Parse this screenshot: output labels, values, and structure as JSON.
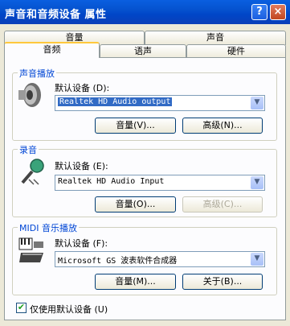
{
  "window": {
    "title": "声音和音频设备 属性",
    "help_label": "?",
    "close_label": "×"
  },
  "tabs": {
    "row1": [
      "音量",
      "声音"
    ],
    "row2": [
      "音频",
      "语声",
      "硬件"
    ]
  },
  "playback": {
    "title": "声音播放",
    "device_label": "默认设备 (D):",
    "device_value": "Realtek HD Audio output",
    "volume_button": "音量(V)...",
    "advanced_button": "高级(N)..."
  },
  "recording": {
    "title": "录音",
    "device_label": "默认设备 (E):",
    "device_value": "Realtek HD Audio Input",
    "volume_button": "音量(O)...",
    "advanced_button": "高级(C)..."
  },
  "midi": {
    "title": "MIDI 音乐播放",
    "device_label": "默认设备 (F):",
    "device_value": "Microsoft GS 波表软件合成器",
    "volume_button": "音量(M)...",
    "about_button": "关于(B)..."
  },
  "default_only": {
    "label": "仅使用默认设备 (U)",
    "checked": true
  }
}
